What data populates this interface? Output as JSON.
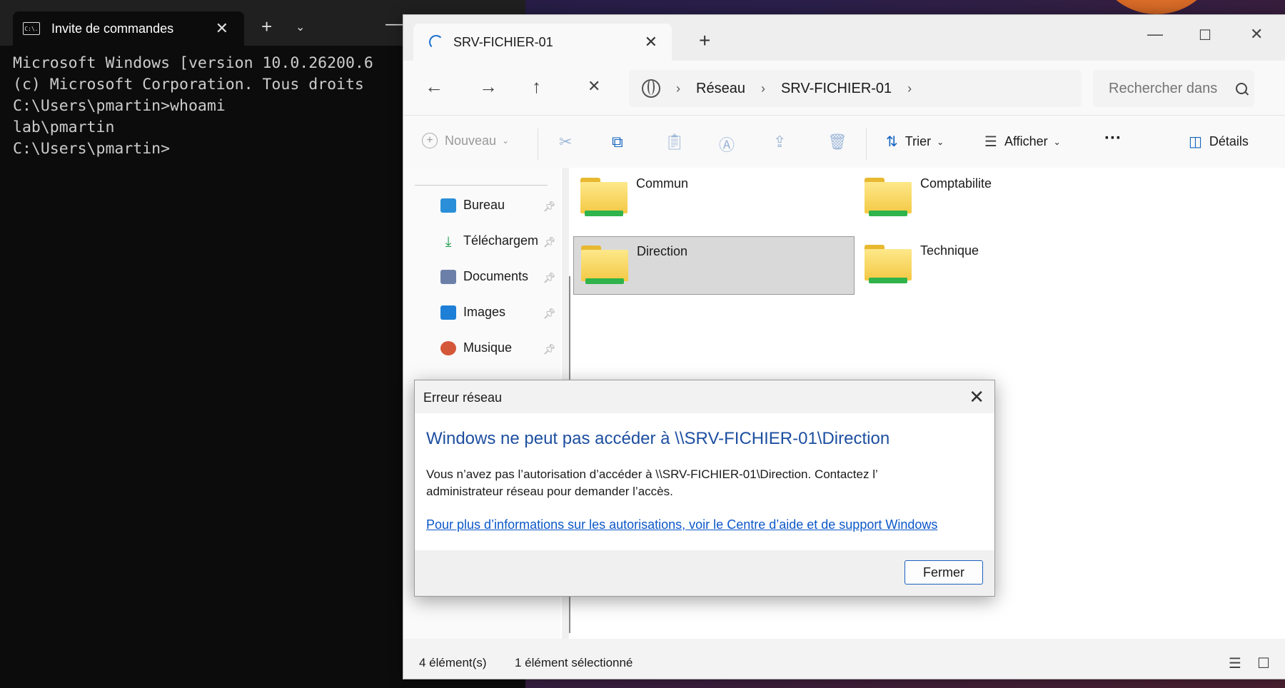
{
  "terminal": {
    "tab_title": "Invite de commandes",
    "tab_icon_text": "C:\\.",
    "lines": [
      "Microsoft Windows [version 10.0.26200.6",
      "(c) Microsoft Corporation. Tous droits",
      "",
      "C:\\Users\\pmartin>whoami",
      "lab\\pmartin",
      "",
      "C:\\Users\\pmartin>"
    ]
  },
  "explorer": {
    "tab_title": "SRV-FICHIER-01",
    "breadcrumb": [
      "Réseau",
      "SRV-FICHIER-01"
    ],
    "search_placeholder": "Rechercher dans",
    "toolbar": {
      "new_label": "Nouveau",
      "sort_label": "Trier",
      "view_label": "Afficher",
      "more_label": "···",
      "details_label": "Détails"
    },
    "nav_items": [
      {
        "label": "Bureau"
      },
      {
        "label": "Téléchargem"
      },
      {
        "label": "Documents"
      },
      {
        "label": "Images"
      },
      {
        "label": "Musique"
      }
    ],
    "folders": [
      {
        "label": "Commun"
      },
      {
        "label": "Comptabilite"
      },
      {
        "label": "Direction",
        "selected": true
      },
      {
        "label": "Technique"
      }
    ],
    "status": {
      "count": "4 élément(s)",
      "selection": "1 élément sélectionné"
    }
  },
  "dialog": {
    "title": "Erreur réseau",
    "heading": "Windows ne peut pas accéder à \\\\SRV-FICHIER-01\\Direction",
    "message": "Vous n’avez pas l’autorisation d’accéder à \\\\SRV-FICHIER-01\\Direction. Contactez l’ administrateur réseau pour demander l’accès.",
    "link": "Pour plus d’informations sur les autorisations, voir le Centre d’aide et de support Windows",
    "button": "Fermer"
  },
  "colors": {
    "accent": "#1a6fd0",
    "dialog_heading": "#1d4fa0",
    "link": "#0b57c8",
    "folder": "#f4c945",
    "network_bar": "#2fb34a"
  }
}
